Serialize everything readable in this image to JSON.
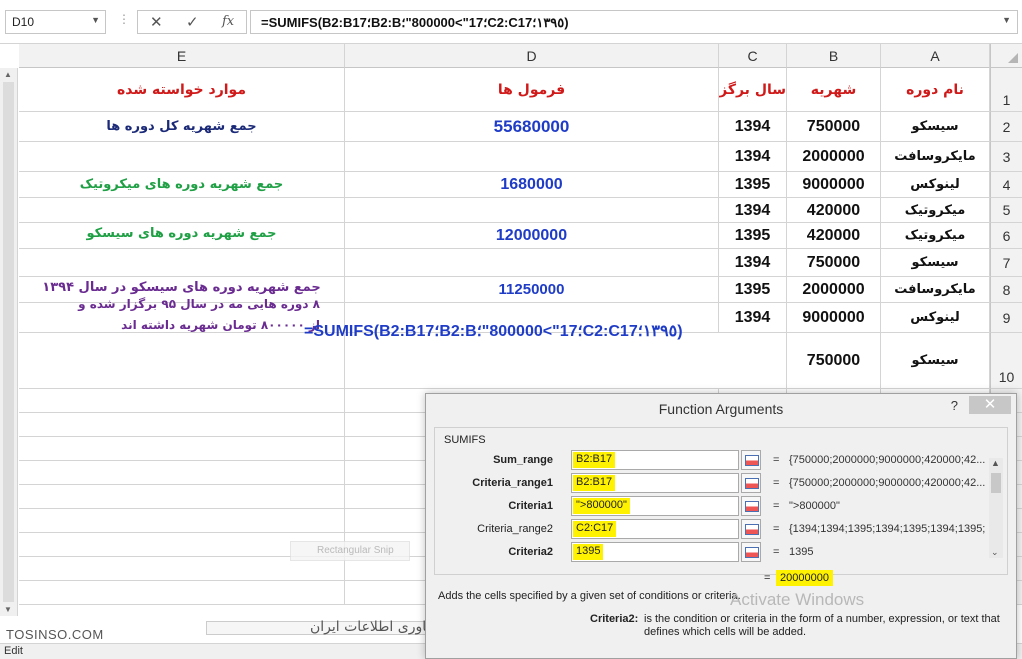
{
  "formula_bar": {
    "name_box": "D10",
    "cancel_glyph": "✕",
    "enter_glyph": "✓",
    "fx_glyph": "fx",
    "formula": "=SUMIFS(B2:B؛17B2:B؛17\">800000\"؛C2:C١٣٩٥؛17)"
  },
  "columns": [
    "E",
    "D",
    "C",
    "B",
    "A"
  ],
  "rows": [
    "1",
    "2",
    "3",
    "4",
    "5",
    "6",
    "7",
    "8",
    "9",
    "10"
  ],
  "headers": {
    "A": "نام دوره",
    "B": "شهریه",
    "C": "سال برگزار",
    "D": "فرمول ها",
    "E": "موارد خواسته شده"
  },
  "table": [
    {
      "A": "سیسکو",
      "B": "750000",
      "C": "1394"
    },
    {
      "A": "مایکروسافت",
      "B": "2000000",
      "C": "1394"
    },
    {
      "A": "لینوکس",
      "B": "9000000",
      "C": "1395"
    },
    {
      "A": "میکروتیک",
      "B": "420000",
      "C": "1394"
    },
    {
      "A": "میکروتیک",
      "B": "420000",
      "C": "1395"
    },
    {
      "A": "سیسکو",
      "B": "750000",
      "C": "1394"
    },
    {
      "A": "مایکروسافت",
      "B": "2000000",
      "C": "1395"
    },
    {
      "A": "لینوکس",
      "B": "9000000",
      "C": "1394"
    },
    {
      "A": "سیسکو",
      "B": "750000",
      "C": ""
    }
  ],
  "questions": {
    "q1": "جمع شهریه کل دوره ها",
    "q2": "جمع شهریه دوره های میکروتیک",
    "q3": "جمع شهریه دوره های سیسکو",
    "q4": "جمع شهریه دوره های سیسکو در سال ۱۳۹۴",
    "q5_line1": "۸ دوره هایی مه در سال ۹۵ برگزار شده و",
    "q5_line2": "از ۸۰۰۰۰۰ تومان شهریه داشته اند"
  },
  "results": {
    "r1": "55680000",
    "r2": "1680000",
    "r3": "12000000",
    "r4": "11250000",
    "r5_formula": "=SUMIFS(B2:B؛17B2:B؛17\">800000\"؛C2:C١٣٩٥؛17)"
  },
  "dialog": {
    "title": "Function Arguments",
    "help": "?",
    "close": "✕",
    "function_name": "SUMIFS",
    "args": [
      {
        "label": "Sum_range",
        "value": "B2:B17",
        "result": "{750000;2000000;9000000;420000;42..."
      },
      {
        "label": "Criteria_range1",
        "value": "B2:B17",
        "result": "{750000;2000000;9000000;420000;42..."
      },
      {
        "label": "Criteria1",
        "value": "\">800000\"",
        "result": "\">800000\""
      },
      {
        "label": "Criteria_range2",
        "value": "C2:C17",
        "result": "{1394;1394;1395;1394;1395;1394;1395;"
      },
      {
        "label": "Criteria2",
        "value": "1395",
        "result": "1395"
      }
    ],
    "equals": "=",
    "total": "20000000",
    "description": "Adds the cells specified by a given set of conditions or criteria.",
    "activate_text": "Activate Windows",
    "crit_label": "Criteria2:",
    "crit_desc": "is the condition or criteria in the form of a number, expression, or text that defines which cells will be added."
  },
  "snip_label": "Rectangular Snip",
  "status": {
    "mode": "Edit"
  },
  "watermark": {
    "left": "TOSINSO.COM",
    "right": "توسینسو - وب سایت تخصصی فناوری اطلاعات ایران"
  }
}
